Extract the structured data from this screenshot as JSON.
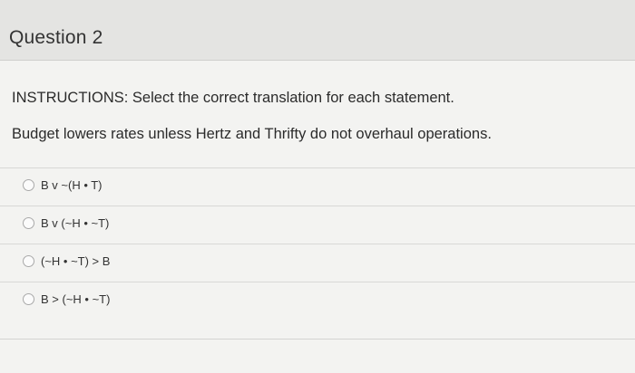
{
  "question": {
    "title": "Question 2"
  },
  "instructions": {
    "label": "INSTRUCTIONS:",
    "text": " Select the correct translation for each statement."
  },
  "statement": "Budget lowers rates unless Hertz and Thrifty do not overhaul operations.",
  "options": [
    {
      "label": "B v ~(H • T)"
    },
    {
      "label": "B v (~H • ~T)"
    },
    {
      "label": "(~H • ~T) > B"
    },
    {
      "label": "B > (~H • ~T)"
    }
  ]
}
